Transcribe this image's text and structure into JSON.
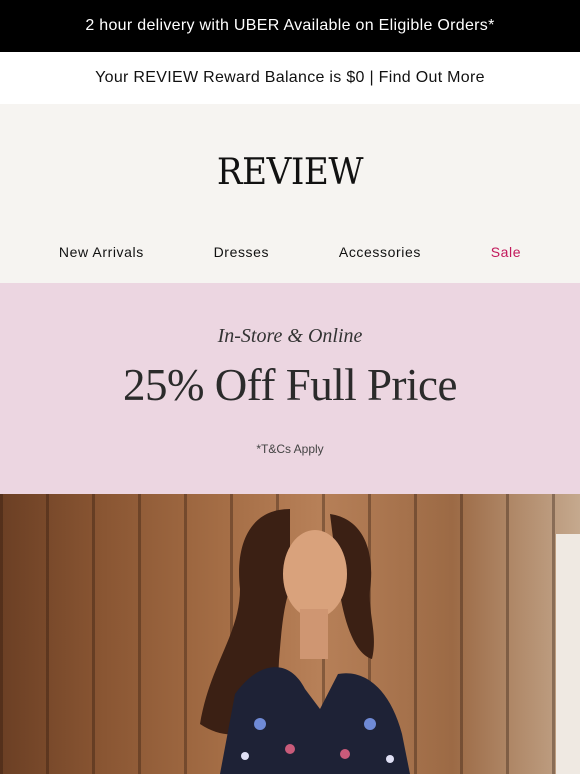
{
  "topbar": {
    "text": "2 hour delivery with UBER Available on Eligible Orders*"
  },
  "rewardbar": {
    "text": "Your REVIEW Reward Balance is $0 | Find Out More"
  },
  "header": {
    "logo": "REVIEW"
  },
  "nav": {
    "items": [
      {
        "label": "New Arrivals"
      },
      {
        "label": "Dresses"
      },
      {
        "label": "Accessories"
      },
      {
        "label": "Sale",
        "color": "#c2185b"
      }
    ]
  },
  "promo": {
    "subtitle": "In-Store & Online",
    "title": "25% Off Full Price",
    "terms": "*T&Cs Apply",
    "background": "#ecd6e1"
  },
  "colors": {
    "topbar": "#000000",
    "header_bg": "#f6f4f1",
    "sale": "#c2185b"
  }
}
